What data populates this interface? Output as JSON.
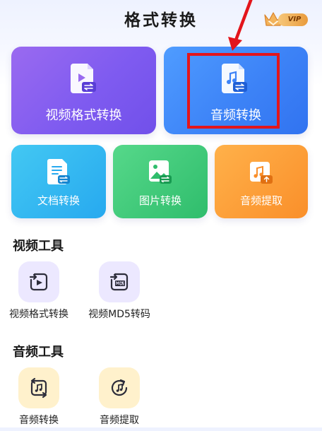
{
  "header": {
    "title": "格式转换",
    "vip_label": "VIP"
  },
  "main_cards": [
    {
      "label": "视频格式转换",
      "icon": "video-file-convert-icon"
    },
    {
      "label": "音频转换",
      "icon": "audio-file-convert-icon"
    }
  ],
  "small_cards": [
    {
      "label": "文档转换",
      "icon": "document-convert-icon"
    },
    {
      "label": "图片转换",
      "icon": "image-convert-icon"
    },
    {
      "label": "音频提取",
      "icon": "audio-extract-icon"
    }
  ],
  "video_tools": {
    "title": "视频工具",
    "items": [
      {
        "label": "视频格式转换",
        "icon": "video-format-icon"
      },
      {
        "label": "视频MD5转码",
        "icon": "video-md5-icon"
      }
    ]
  },
  "audio_tools": {
    "title": "音频工具",
    "items": [
      {
        "label": "音频转换",
        "icon": "audio-convert-icon"
      },
      {
        "label": "音频提取",
        "icon": "audio-extract-tool-icon"
      }
    ]
  },
  "colors": {
    "video_card": "#7f5bf0",
    "audio_card": "#3d83f7",
    "doc_card": "#27a9ef",
    "image_card": "#2fbd6c",
    "extract_card": "#fa8f2a",
    "annotation": "#e3151b",
    "vip_gold": "#e99b3c"
  }
}
